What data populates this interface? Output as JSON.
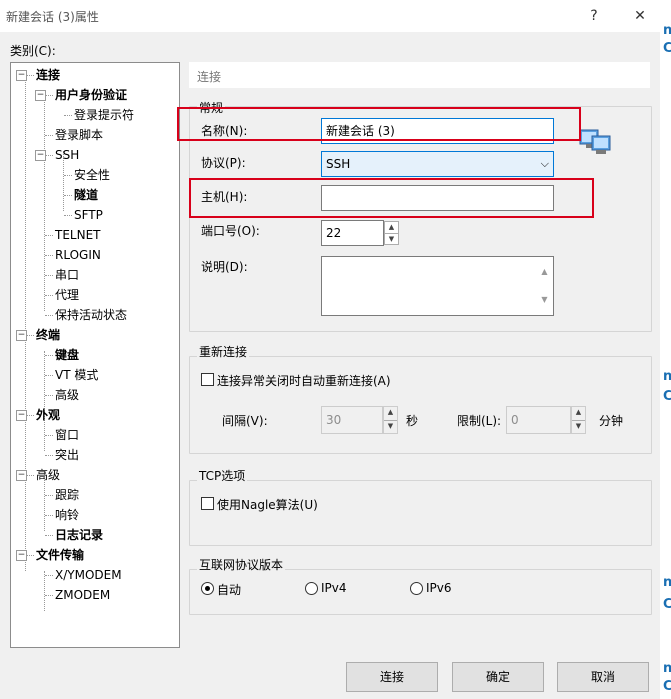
{
  "window": {
    "title": "新建会话 (3)属性",
    "help": "?",
    "close": "✕"
  },
  "category_label": "类别(C):",
  "tree": [
    {
      "key": "lianjie",
      "label": "连接",
      "bold": true
    },
    {
      "key": "yonghu",
      "label": "用户身份验证",
      "bold": true
    },
    {
      "key": "denglutishi",
      "label": "登录提示符",
      "bold": false
    },
    {
      "key": "denglujiaoben",
      "label": "登录脚本",
      "bold": false
    },
    {
      "key": "ssh",
      "label": "SSH",
      "bold": false
    },
    {
      "key": "anquanxing",
      "label": "安全性",
      "bold": false
    },
    {
      "key": "suidao",
      "label": "隧道",
      "bold": true
    },
    {
      "key": "sftp",
      "label": "SFTP",
      "bold": false
    },
    {
      "key": "telnet",
      "label": "TELNET",
      "bold": false
    },
    {
      "key": "rlogin",
      "label": "RLOGIN",
      "bold": false
    },
    {
      "key": "chuankou",
      "label": "串口",
      "bold": false
    },
    {
      "key": "daili",
      "label": "代理",
      "bold": false
    },
    {
      "key": "baochi",
      "label": "保持活动状态",
      "bold": false
    },
    {
      "key": "zhongduan",
      "label": "终端",
      "bold": true
    },
    {
      "key": "jianpan",
      "label": "键盘",
      "bold": true
    },
    {
      "key": "vt",
      "label": "VT 模式",
      "bold": false
    },
    {
      "key": "gaoji1",
      "label": "高级",
      "bold": false
    },
    {
      "key": "waiguan",
      "label": "外观",
      "bold": true
    },
    {
      "key": "chuangkou",
      "label": "窗口",
      "bold": false
    },
    {
      "key": "tuchu",
      "label": "突出",
      "bold": false
    },
    {
      "key": "gaoji2",
      "label": "高级",
      "bold": false
    },
    {
      "key": "genzong",
      "label": "跟踪",
      "bold": false
    },
    {
      "key": "xiangling",
      "label": "响铃",
      "bold": false
    },
    {
      "key": "rizhi",
      "label": "日志记录",
      "bold": true
    },
    {
      "key": "wenjian",
      "label": "文件传输",
      "bold": true
    },
    {
      "key": "xymodem",
      "label": "X/YMODEM",
      "bold": false
    },
    {
      "key": "zmodem",
      "label": "ZMODEM",
      "bold": false
    }
  ],
  "expander": "−",
  "header": "连接",
  "general": {
    "legend": "常规",
    "name_label": "名称(N):",
    "name_value": "新建会话 (3)",
    "protocol_label": "协议(P):",
    "protocol_value": "SSH",
    "combo_arrow": "⌵",
    "host_label": "主机(H):",
    "host_value": "",
    "port_label": "端口号(O):",
    "port_value": "22",
    "desc_label": "说明(D):",
    "desc_value": "",
    "spin_up": "▲",
    "spin_down": "▼"
  },
  "reconnect": {
    "legend": "重新连接",
    "auto_label": "连接异常关闭时自动重新连接(A)",
    "interval_label": "间隔(V):",
    "interval_value": "30",
    "interval_unit": "秒",
    "limit_label": "限制(L):",
    "limit_value": "0",
    "limit_unit": "分钟"
  },
  "tcp": {
    "legend": "TCP选项",
    "nagle_label": "使用Nagle算法(U)"
  },
  "ipver": {
    "legend": "互联网协议版本",
    "auto": "自动",
    "ipv4": "IPv4",
    "ipv6": "IPv6",
    "selected": "auto"
  },
  "buttons": {
    "connect": "连接",
    "ok": "确定",
    "cancel": "取消"
  },
  "right_strip": [
    "n",
    "C",
    "n",
    "C",
    "n",
    "C",
    "n",
    "C"
  ],
  "colors": {
    "highlight": "#d8001a",
    "focus": "#0078d7"
  }
}
